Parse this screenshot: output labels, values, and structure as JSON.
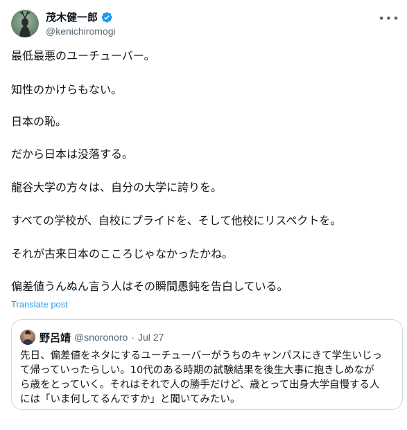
{
  "author": {
    "display_name": "茂木健一郎",
    "handle": "@kenichiromogi",
    "verified": true,
    "avatar_icon": "avatar-icon",
    "verified_color": "#1d9bf0"
  },
  "more_icon": "more-options-icon",
  "post": {
    "paragraphs": [
      "最低最悪のユーチューバー。",
      "知性のかけらもない。",
      "日本の恥。",
      "だから日本は没落する。",
      "龍谷大学の方々は、自分の大学に誇りを。",
      "すべての学校が、自校にプライドを、そして他校にリスペクトを。",
      "それが古来日本のこころじゃなかったかね。",
      "偏差値うんぬん言う人はその瞬間愚鈍を告白している。"
    ],
    "translate_label": "Translate post"
  },
  "quote": {
    "display_name": "野呂靖",
    "handle": "@snoronoro",
    "separator": "·",
    "date": "Jul 27",
    "lines": [
      "先日、偏差値をネタにするユーチューバーがうちのキャンパスにきて学生いじっ",
      "て帰っていったらしい。10代のある時期の試験結果を後生大事に抱きしめなが",
      "ら歳をとっていく。それはそれで人の勝手だけど、歳とって出身大学自慢する人",
      "には「いま何してるんですか」と聞いてみたい。"
    ]
  },
  "colors": {
    "text": "#0f1419",
    "secondary": "#536471",
    "link": "#1d9bf0",
    "border": "#cfd9de"
  }
}
